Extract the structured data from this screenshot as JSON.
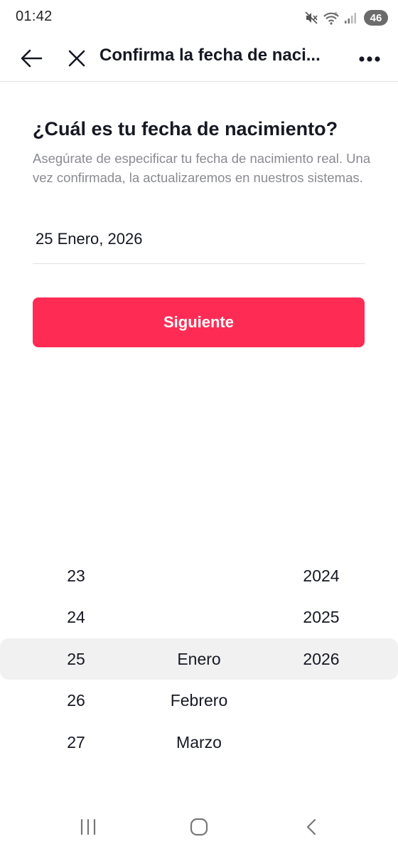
{
  "status_bar": {
    "time": "01:42",
    "battery_level": "46",
    "icons": [
      "mute-icon",
      "wifi-icon",
      "signal-icon",
      "battery-icon"
    ]
  },
  "header": {
    "title": "Confirma la fecha de naci...",
    "icons": [
      "back-arrow-icon",
      "close-icon",
      "more-icon"
    ]
  },
  "main": {
    "heading": "¿Cuál es tu fecha de nacimiento?",
    "description": "Asegúrate de especificar tu fecha de nacimiento real. Una vez confirmada, la actualizaremos en nuestros sistemas.",
    "date_value": "25 Enero, 2026",
    "next_button_label": "Siguiente"
  },
  "picker": {
    "days": [
      "23",
      "24",
      "25",
      "26",
      "27"
    ],
    "months": [
      "",
      "",
      "Enero",
      "Febrero",
      "Marzo"
    ],
    "years": [
      "2024",
      "2025",
      "2026",
      "",
      ""
    ],
    "selected": {
      "day": "25",
      "month": "Enero",
      "year": "2026"
    }
  },
  "system_nav": {
    "icons": [
      "recents-icon",
      "home-icon",
      "system-back-icon"
    ]
  },
  "colors": {
    "accent": "#fe2c55",
    "text": "#161823",
    "secondary_text": "#8a8b91",
    "picker_highlight": "#f1f1f2"
  }
}
